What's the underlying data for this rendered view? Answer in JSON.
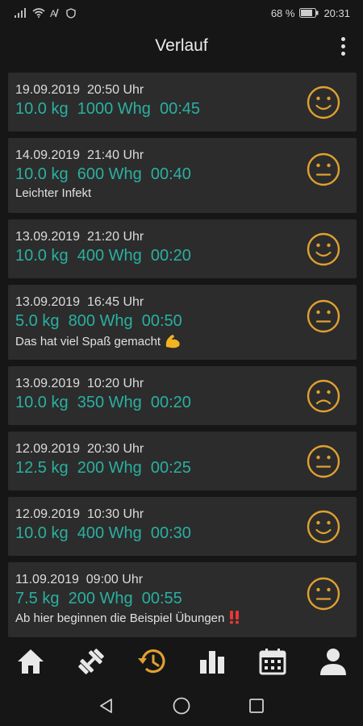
{
  "status": {
    "battery": "68 %",
    "time": "20:31"
  },
  "header": {
    "title": "Verlauf"
  },
  "entries": [
    {
      "date": "19.09.2019  20:50 Uhr",
      "stats": "10.0 kg  1000 Whg  00:45",
      "note": "",
      "mood": "happy"
    },
    {
      "date": "14.09.2019  21:40 Uhr",
      "stats": "10.0 kg  600 Whg  00:40",
      "note": "Leichter Infekt",
      "mood": "neutral"
    },
    {
      "date": "13.09.2019  21:20 Uhr",
      "stats": "10.0 kg  400 Whg  00:20",
      "note": "",
      "mood": "happy"
    },
    {
      "date": "13.09.2019  16:45 Uhr",
      "stats": "5.0 kg  800 Whg  00:50",
      "note": "Das hat viel Spaß gemacht",
      "mood": "neutral"
    },
    {
      "date": "13.09.2019  10:20 Uhr",
      "stats": "10.0 kg  350 Whg  00:20",
      "note": "",
      "mood": "sad"
    },
    {
      "date": "12.09.2019  20:30 Uhr",
      "stats": "12.5 kg  200 Whg  00:25",
      "note": "",
      "mood": "neutral"
    },
    {
      "date": "12.09.2019  10:30 Uhr",
      "stats": "10.0 kg  400 Whg  00:30",
      "note": "",
      "mood": "happy"
    },
    {
      "date": "11.09.2019  09:00 Uhr",
      "stats": "7.5 kg  200 Whg  00:55",
      "note": "Ab hier beginnen die Beispiel Übungen",
      "mood": "neutral"
    }
  ],
  "nav": {
    "items": [
      "home-icon",
      "dumbbell-icon",
      "history-icon",
      "bar-chart-icon",
      "calendar-icon",
      "person-icon"
    ],
    "active": "history-icon"
  },
  "colors": {
    "accent": "#2ab0a0",
    "mood": "#e0a030",
    "active_nav": "#e0a030",
    "inactive_nav": "#e8e8e8"
  }
}
